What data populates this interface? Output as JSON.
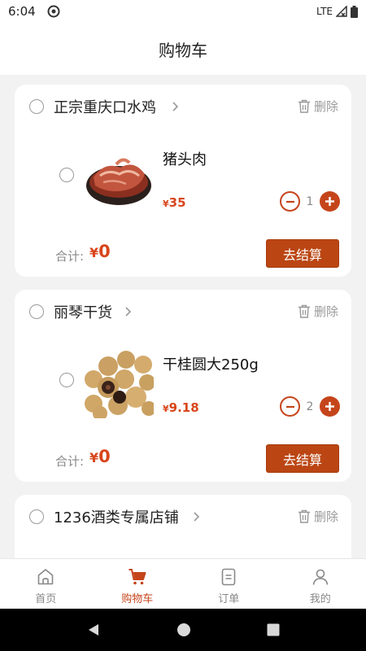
{
  "status_bar": {
    "time": "6:04",
    "network": "LTE"
  },
  "header": {
    "title": "购物车"
  },
  "shops": [
    {
      "name": "正宗重庆口水鸡",
      "delete_label": "删除",
      "item": {
        "name": "猪头肉",
        "currency": "¥",
        "price": "35",
        "quantity": "1"
      },
      "total_label": "合计:",
      "total_currency": "¥",
      "total_value": "0",
      "checkout_label": "去结算"
    },
    {
      "name": "丽琴干货",
      "delete_label": "删除",
      "item": {
        "name": "干桂圆大250g",
        "currency": "¥",
        "price": "9.18",
        "quantity": "2"
      },
      "total_label": "合计:",
      "total_currency": "¥",
      "total_value": "0",
      "checkout_label": "去结算"
    },
    {
      "name": "1236酒类专属店铺",
      "delete_label": "删除"
    }
  ],
  "tabs": [
    {
      "label": "首页",
      "icon": "home-icon",
      "active": false
    },
    {
      "label": "购物车",
      "icon": "cart-icon",
      "active": true
    },
    {
      "label": "订单",
      "icon": "order-icon",
      "active": false
    },
    {
      "label": "我的",
      "icon": "profile-icon",
      "active": false
    }
  ],
  "colors": {
    "accent": "#c5451b",
    "price": "#d8461c",
    "button": "#bb4613"
  }
}
